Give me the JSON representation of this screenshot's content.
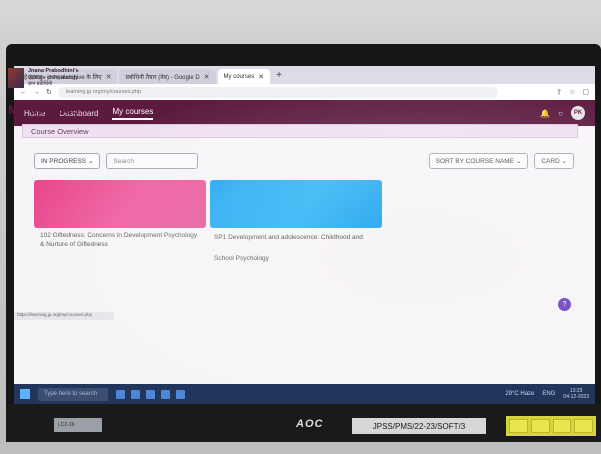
{
  "browser": {
    "tabs": [
      {
        "label": "हे इंद्रधनु - journalarchive के लिए",
        "active": false
      },
      {
        "label": "प्रबोधिनी तैयार (वेब) - Google D",
        "active": false
      },
      {
        "label": "My courses",
        "active": true
      }
    ],
    "url": "learning.jp.org/my/courses.php"
  },
  "navbar": {
    "links": [
      "Home",
      "Dashboard",
      "My courses"
    ],
    "avatar_initials": "PK"
  },
  "logo": {
    "line1": "Jnana Prabodhini's",
    "line2": "Institute of Psychology",
    "line3": "ज्ञान प्रबोधिनी"
  },
  "page": {
    "title": "My courses",
    "section": "Course Overview"
  },
  "filters": {
    "progress_label": "IN PROGRESS",
    "search_placeholder": "Search",
    "sort_label": "SORT BY COURSE NAME",
    "view_label": "CARD"
  },
  "courses": [
    {
      "title": "102 Giftedness: Concerns in Development Psychology & Nurture of Giftedness",
      "color": "#e8488c"
    },
    {
      "title": "SP1 Development and adolescence: Childhood and",
      "title_line2": "School Psychology",
      "color": "#1aa3f0"
    }
  ],
  "help": {
    "label": "?"
  },
  "status_bar": "https://learning.jp.org/my/courses.php",
  "taskbar": {
    "search_placeholder": "Type here to search",
    "weather": "29°C Haze",
    "lang": "ENG",
    "time": "13:23",
    "date": "04-12-2023"
  },
  "monitor": {
    "brand": "AOC",
    "asset_label": "JPSS/PMS/22-23/SOFT/3",
    "side_sticker": "LC2-16"
  }
}
